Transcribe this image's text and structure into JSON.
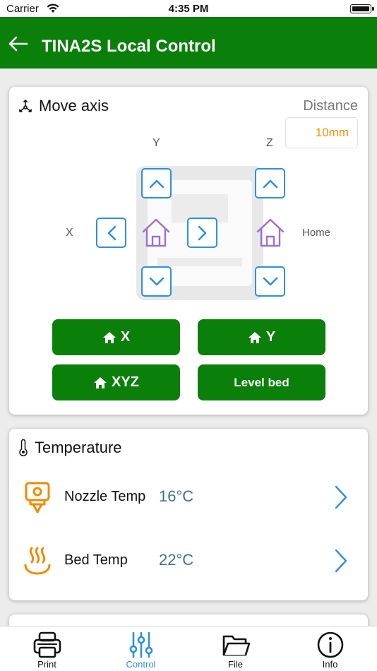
{
  "status_bar": {
    "carrier": "Carrier",
    "time": "4:35 PM"
  },
  "navbar": {
    "back_icon": "arrow-left-icon",
    "title": "TINA2S Local Control"
  },
  "move_axis": {
    "title": "Move axis",
    "title_icon": "axes-icon",
    "distance_label": "Distance",
    "distance_value": "10mm",
    "y_label": "Y",
    "z_label": "Z",
    "x_label": "X",
    "home_label": "Home",
    "buttons": {
      "home_x": "X",
      "home_y": "Y",
      "home_xyz": "XYZ",
      "level_bed": "Level bed"
    },
    "colors": {
      "arrow": "#2f8fdf",
      "home": "#9b6fd8",
      "button": "#0a7f0a",
      "distance_value": "#ef9200"
    }
  },
  "temperature": {
    "title": "Temperature",
    "title_icon": "thermometer-icon",
    "rows": [
      {
        "label": "Nozzle Temp",
        "value": "16°C",
        "icon": "nozzle-icon"
      },
      {
        "label": "Bed Temp",
        "value": "22°C",
        "icon": "heated-bed-icon"
      }
    ],
    "colors": {
      "value": "#3d6f9e",
      "icon": "#f08a00",
      "chevron": "#2f8fdf"
    }
  },
  "tabbar": {
    "tabs": [
      {
        "label": "Print",
        "icon": "printer-icon",
        "active": false
      },
      {
        "label": "Control",
        "icon": "sliders-icon",
        "active": true
      },
      {
        "label": "File",
        "icon": "folder-icon",
        "active": false
      },
      {
        "label": "Info",
        "icon": "info-icon",
        "active": false
      }
    ],
    "active_color": "#2f8fdf"
  }
}
